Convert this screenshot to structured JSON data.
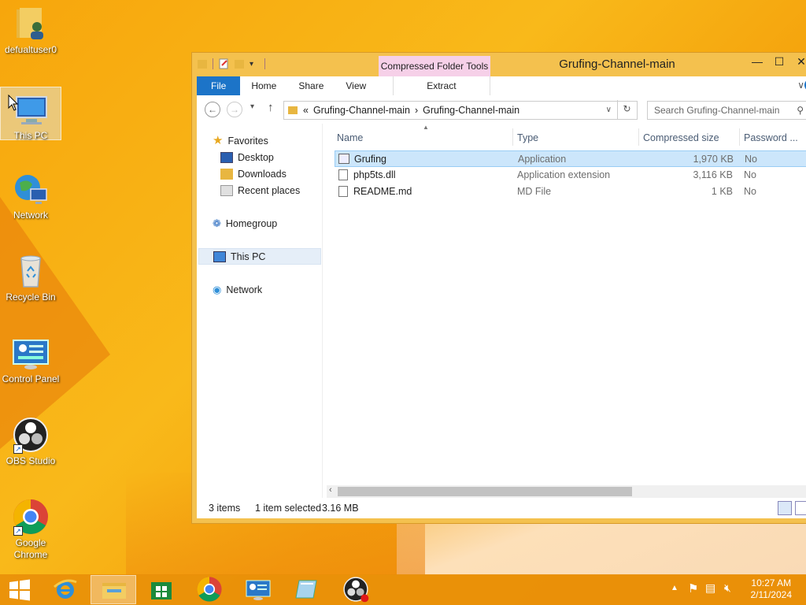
{
  "desktop": {
    "icons": [
      {
        "label": "defualtuser0"
      },
      {
        "label": "This PC"
      },
      {
        "label": "Network"
      },
      {
        "label": "Recycle Bin"
      },
      {
        "label": "Control Panel"
      },
      {
        "label": "OBS Studio"
      },
      {
        "label": "Google Chrome"
      }
    ]
  },
  "window": {
    "title": "Grufing-Channel-main",
    "context_tab_header": "Compressed Folder Tools",
    "tabs": {
      "file": "File",
      "home": "Home",
      "share": "Share",
      "view": "View",
      "extract": "Extract"
    },
    "address": {
      "prefix": "«",
      "segments": [
        "Grufing-Channel-main",
        "Grufing-Channel-main"
      ]
    },
    "search_placeholder": "Search Grufing-Channel-main",
    "nav": {
      "favorites": "Favorites",
      "desktop": "Desktop",
      "downloads": "Downloads",
      "recent": "Recent places",
      "homegroup": "Homegroup",
      "this_pc": "This PC",
      "network": "Network"
    },
    "columns": {
      "name": "Name",
      "type": "Type",
      "size": "Compressed size",
      "password": "Password ..."
    },
    "files": [
      {
        "name": "Grufing",
        "type": "Application",
        "size": "1,970 KB",
        "password": "No"
      },
      {
        "name": "php5ts.dll",
        "type": "Application extension",
        "size": "3,116 KB",
        "password": "No"
      },
      {
        "name": "README.md",
        "type": "MD File",
        "size": "1 KB",
        "password": "No"
      }
    ],
    "status": {
      "items": "3 items",
      "selected": "1 item selected",
      "size": "3.16 MB"
    }
  },
  "taskbar": {
    "clock_time": "10:27 AM",
    "clock_date": "2/11/2024"
  }
}
